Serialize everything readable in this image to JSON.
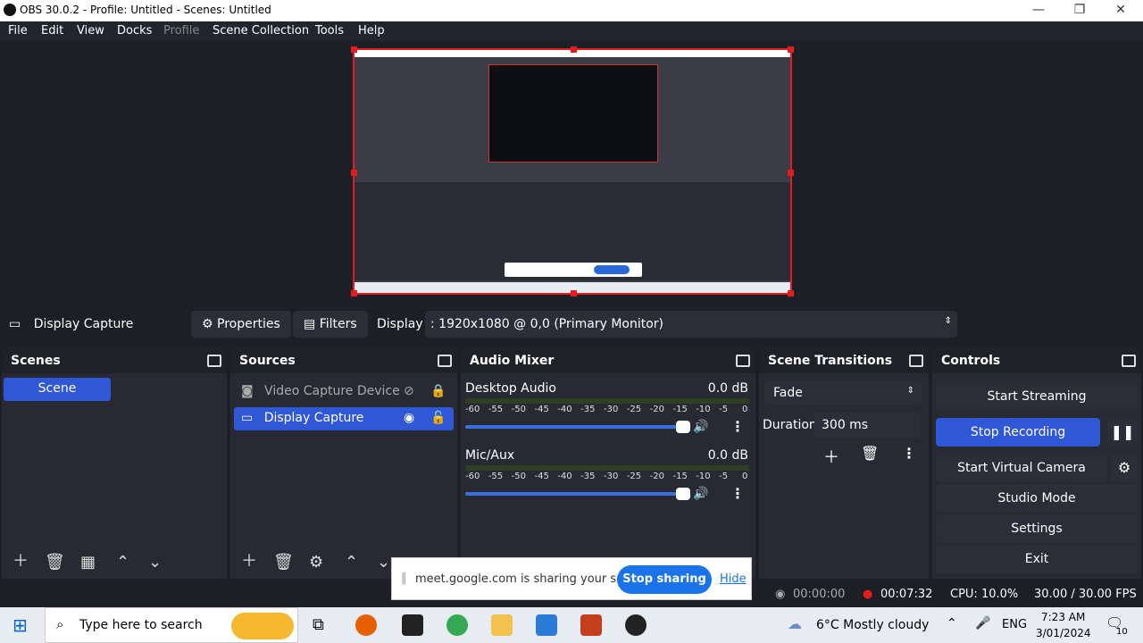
{
  "window": {
    "title": "OBS 30.0.2 - Profile: Untitled - Scenes: Untitled",
    "minimize": "—",
    "restore": "❐",
    "close": "✕"
  },
  "menu": [
    "File",
    "Edit",
    "View",
    "Docks",
    "Profile",
    "Scene Collection",
    "Tools",
    "Help"
  ],
  "source_bar": {
    "current_source": "Display Capture",
    "properties_label": "Properties",
    "filters_label": "Filters",
    "display_label": "Display",
    "display_value": ": 1920x1080 @ 0,0 (Primary Monitor)"
  },
  "scenes": {
    "title": "Scenes",
    "items": [
      "Scene"
    ]
  },
  "sources": {
    "title": "Sources",
    "items": [
      "Video Capture Device",
      "Display Capture"
    ]
  },
  "audio": {
    "title": "Audio Mixer",
    "channels": [
      {
        "name": "Desktop Audio",
        "db": "0.0 dB"
      },
      {
        "name": "Mic/Aux",
        "db": "0.0 dB"
      }
    ],
    "ticks": [
      "-60",
      "-55",
      "-50",
      "-45",
      "-40",
      "-35",
      "-30",
      "-25",
      "-20",
      "-15",
      "-10",
      "-5",
      "0"
    ]
  },
  "transitions": {
    "title": "Scene Transitions",
    "selected": "Fade",
    "duration_label": "Duration",
    "duration_value": "300 ms"
  },
  "controls": {
    "title": "Controls",
    "start_streaming": "Start Streaming",
    "stop_recording": "Stop Recording",
    "start_virtual_camera": "Start Virtual Camera",
    "studio_mode": "Studio Mode",
    "settings": "Settings",
    "exit": "Exit"
  },
  "share_notice": {
    "text": "meet.google.com is sharing your screen.",
    "stop": "Stop sharing",
    "hide": "Hide"
  },
  "status": {
    "stream_time": "00:00:00",
    "rec_time": "00:07:32",
    "cpu": "CPU: 10.0%",
    "fps": "30.00 / 30.00 FPS"
  },
  "taskbar": {
    "search_placeholder": "Type here to search",
    "weather": "6°C  Mostly cloudy",
    "lang": "ENG",
    "time": "7:23 AM",
    "date": "3/01/2024",
    "notifications": "10"
  },
  "colors": {
    "accent": "#2f57d6",
    "recording": "#e51c1c",
    "panel": "#272a33",
    "background": "#1d1f26"
  }
}
